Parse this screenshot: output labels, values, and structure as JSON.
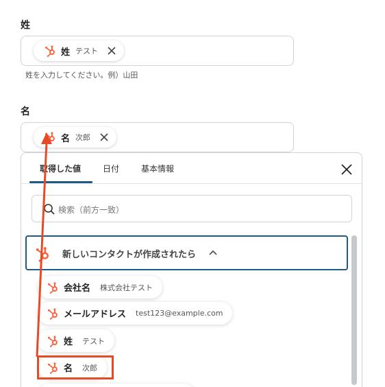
{
  "fields": [
    {
      "label": "姓",
      "chip": {
        "icon": "hubspot-icon",
        "name": "姓",
        "value": "テスト"
      },
      "helper": "姓を入力してください。例）山田"
    },
    {
      "label": "名",
      "chip": {
        "icon": "hubspot-icon",
        "name": "名",
        "value": "次郎"
      }
    }
  ],
  "picker": {
    "tabs": [
      {
        "label": "取得した値",
        "active": true
      },
      {
        "label": "日付",
        "active": false
      },
      {
        "label": "基本情報",
        "active": false
      }
    ],
    "close_icon": "close-icon",
    "search": {
      "placeholder": "検索（前方一致）",
      "icon": "search-icon"
    },
    "trigger": {
      "icon": "hubspot-icon",
      "label": "新しいコンタクトが作成されたら",
      "expanded": true
    },
    "items": [
      {
        "name": "会社名",
        "value": "株式会社テスト"
      },
      {
        "name": "メールアドレス",
        "value": "test123@example.com"
      },
      {
        "name": "姓",
        "value": "テスト"
      },
      {
        "name": "名",
        "value": "次郎",
        "highlighted": true
      }
    ]
  },
  "colors": {
    "hubspot": "#ff5c35",
    "annotation": "#e84a26",
    "tab_underline": "#1d5a86",
    "trigger_border": "#1d5a86"
  }
}
